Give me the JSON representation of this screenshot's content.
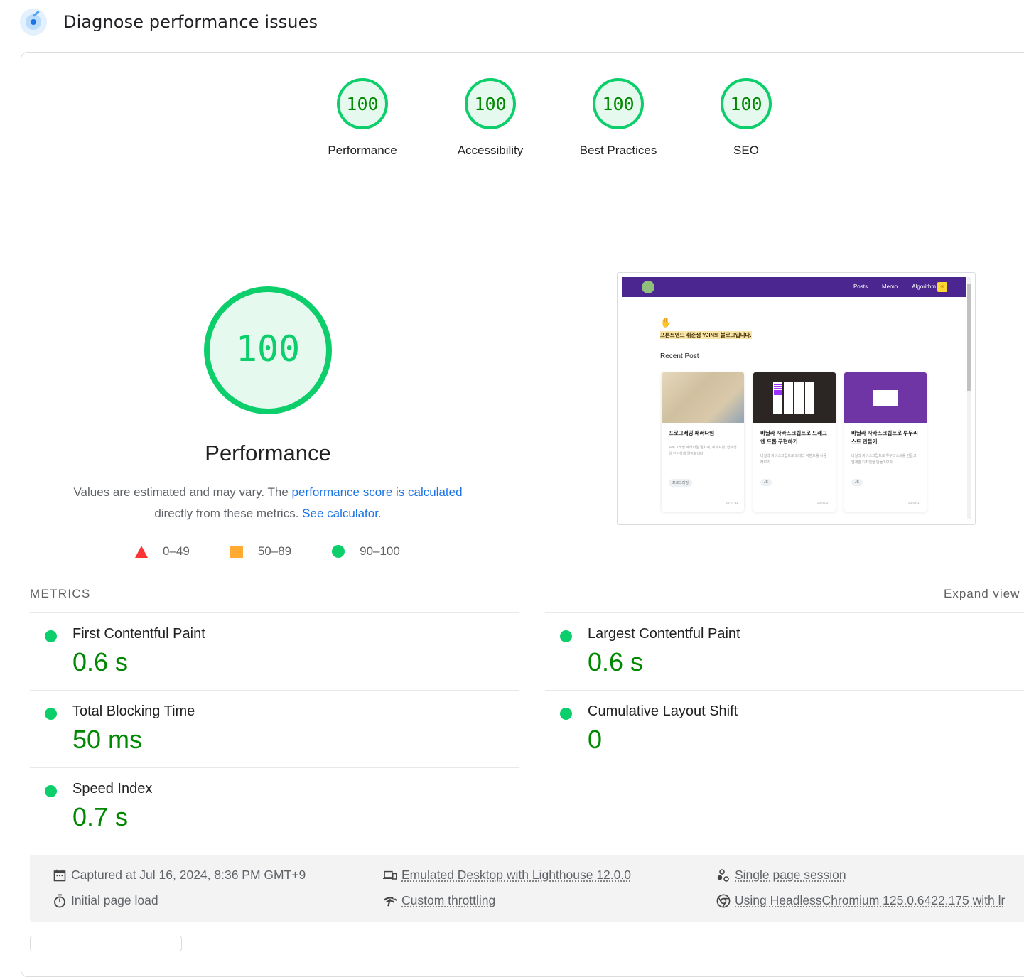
{
  "header": {
    "title": "Diagnose performance issues",
    "icon": "lighthouse-gauge-icon"
  },
  "scores": [
    {
      "label": "Performance",
      "value": "100"
    },
    {
      "label": "Accessibility",
      "value": "100"
    },
    {
      "label": "Best Practices",
      "value": "100"
    },
    {
      "label": "SEO",
      "value": "100"
    }
  ],
  "performance": {
    "score": "100",
    "title": "Performance",
    "desc_prefix": "Values are estimated and may vary. The ",
    "desc_link1": "performance score is calculated",
    "desc_middle": " directly from these metrics. ",
    "desc_link2": "See calculator."
  },
  "legend": [
    {
      "shape": "triangle",
      "range": "0–49",
      "color": "#ff3333"
    },
    {
      "shape": "square",
      "range": "50–89",
      "color": "#ffaa33"
    },
    {
      "shape": "circle",
      "range": "90–100",
      "color": "#0cce6b"
    }
  ],
  "screenshot": {
    "nav_links": [
      "Posts",
      "Memo",
      "Algorithm"
    ],
    "intro": "프론트엔드 취준생 YJIN의 블로그입니다.",
    "recent_heading": "Recent Post",
    "posts": [
      {
        "title": "프로그래밍 패러다임",
        "desc": "프로그래밍 패러다임 절차적, 객체지향, 함수형을 간단하게 알아봅니다.",
        "tag": "프로그래밍",
        "date": "24-07-11"
      },
      {
        "title": "바닐라 자바스크립트로 드래그 앤 드롭 구현하기",
        "desc": "바닐라 자바스크립트로 드래그 이벤트를 사용해보기",
        "tag": "JS",
        "date": "24-06-27"
      },
      {
        "title": "바닐라 자바스크립트로 투두리스트 만들기",
        "desc": "바닐라 자바스크립트로 투두리스트를 만들고 웹개발 디자인을 만들어보자.",
        "tag": "JS",
        "date": "24-06-17"
      }
    ]
  },
  "metrics": {
    "heading": "METRICS",
    "expand_label": "Expand view",
    "items": [
      {
        "name": "First Contentful Paint",
        "value": "0.6 s",
        "status": "pass"
      },
      {
        "name": "Largest Contentful Paint",
        "value": "0.6 s",
        "status": "pass"
      },
      {
        "name": "Total Blocking Time",
        "value": "50 ms",
        "status": "pass"
      },
      {
        "name": "Cumulative Layout Shift",
        "value": "0",
        "status": "pass"
      },
      {
        "name": "Speed Index",
        "value": "0.7 s",
        "status": "pass"
      }
    ]
  },
  "footer": {
    "captured": "Captured at Jul 16, 2024, 8:36 PM GMT+9",
    "load": "Initial page load",
    "device": "Emulated Desktop with Lighthouse 12.0.0",
    "throttling": "Custom throttling",
    "session": "Single page session",
    "browser": "Using HeadlessChromium 125.0.6422.175 with lr"
  },
  "colors": {
    "pass": "#0cce6b",
    "pass_text": "#008800",
    "link": "#1a73e8",
    "average": "#ffaa33",
    "fail": "#ff3333"
  }
}
